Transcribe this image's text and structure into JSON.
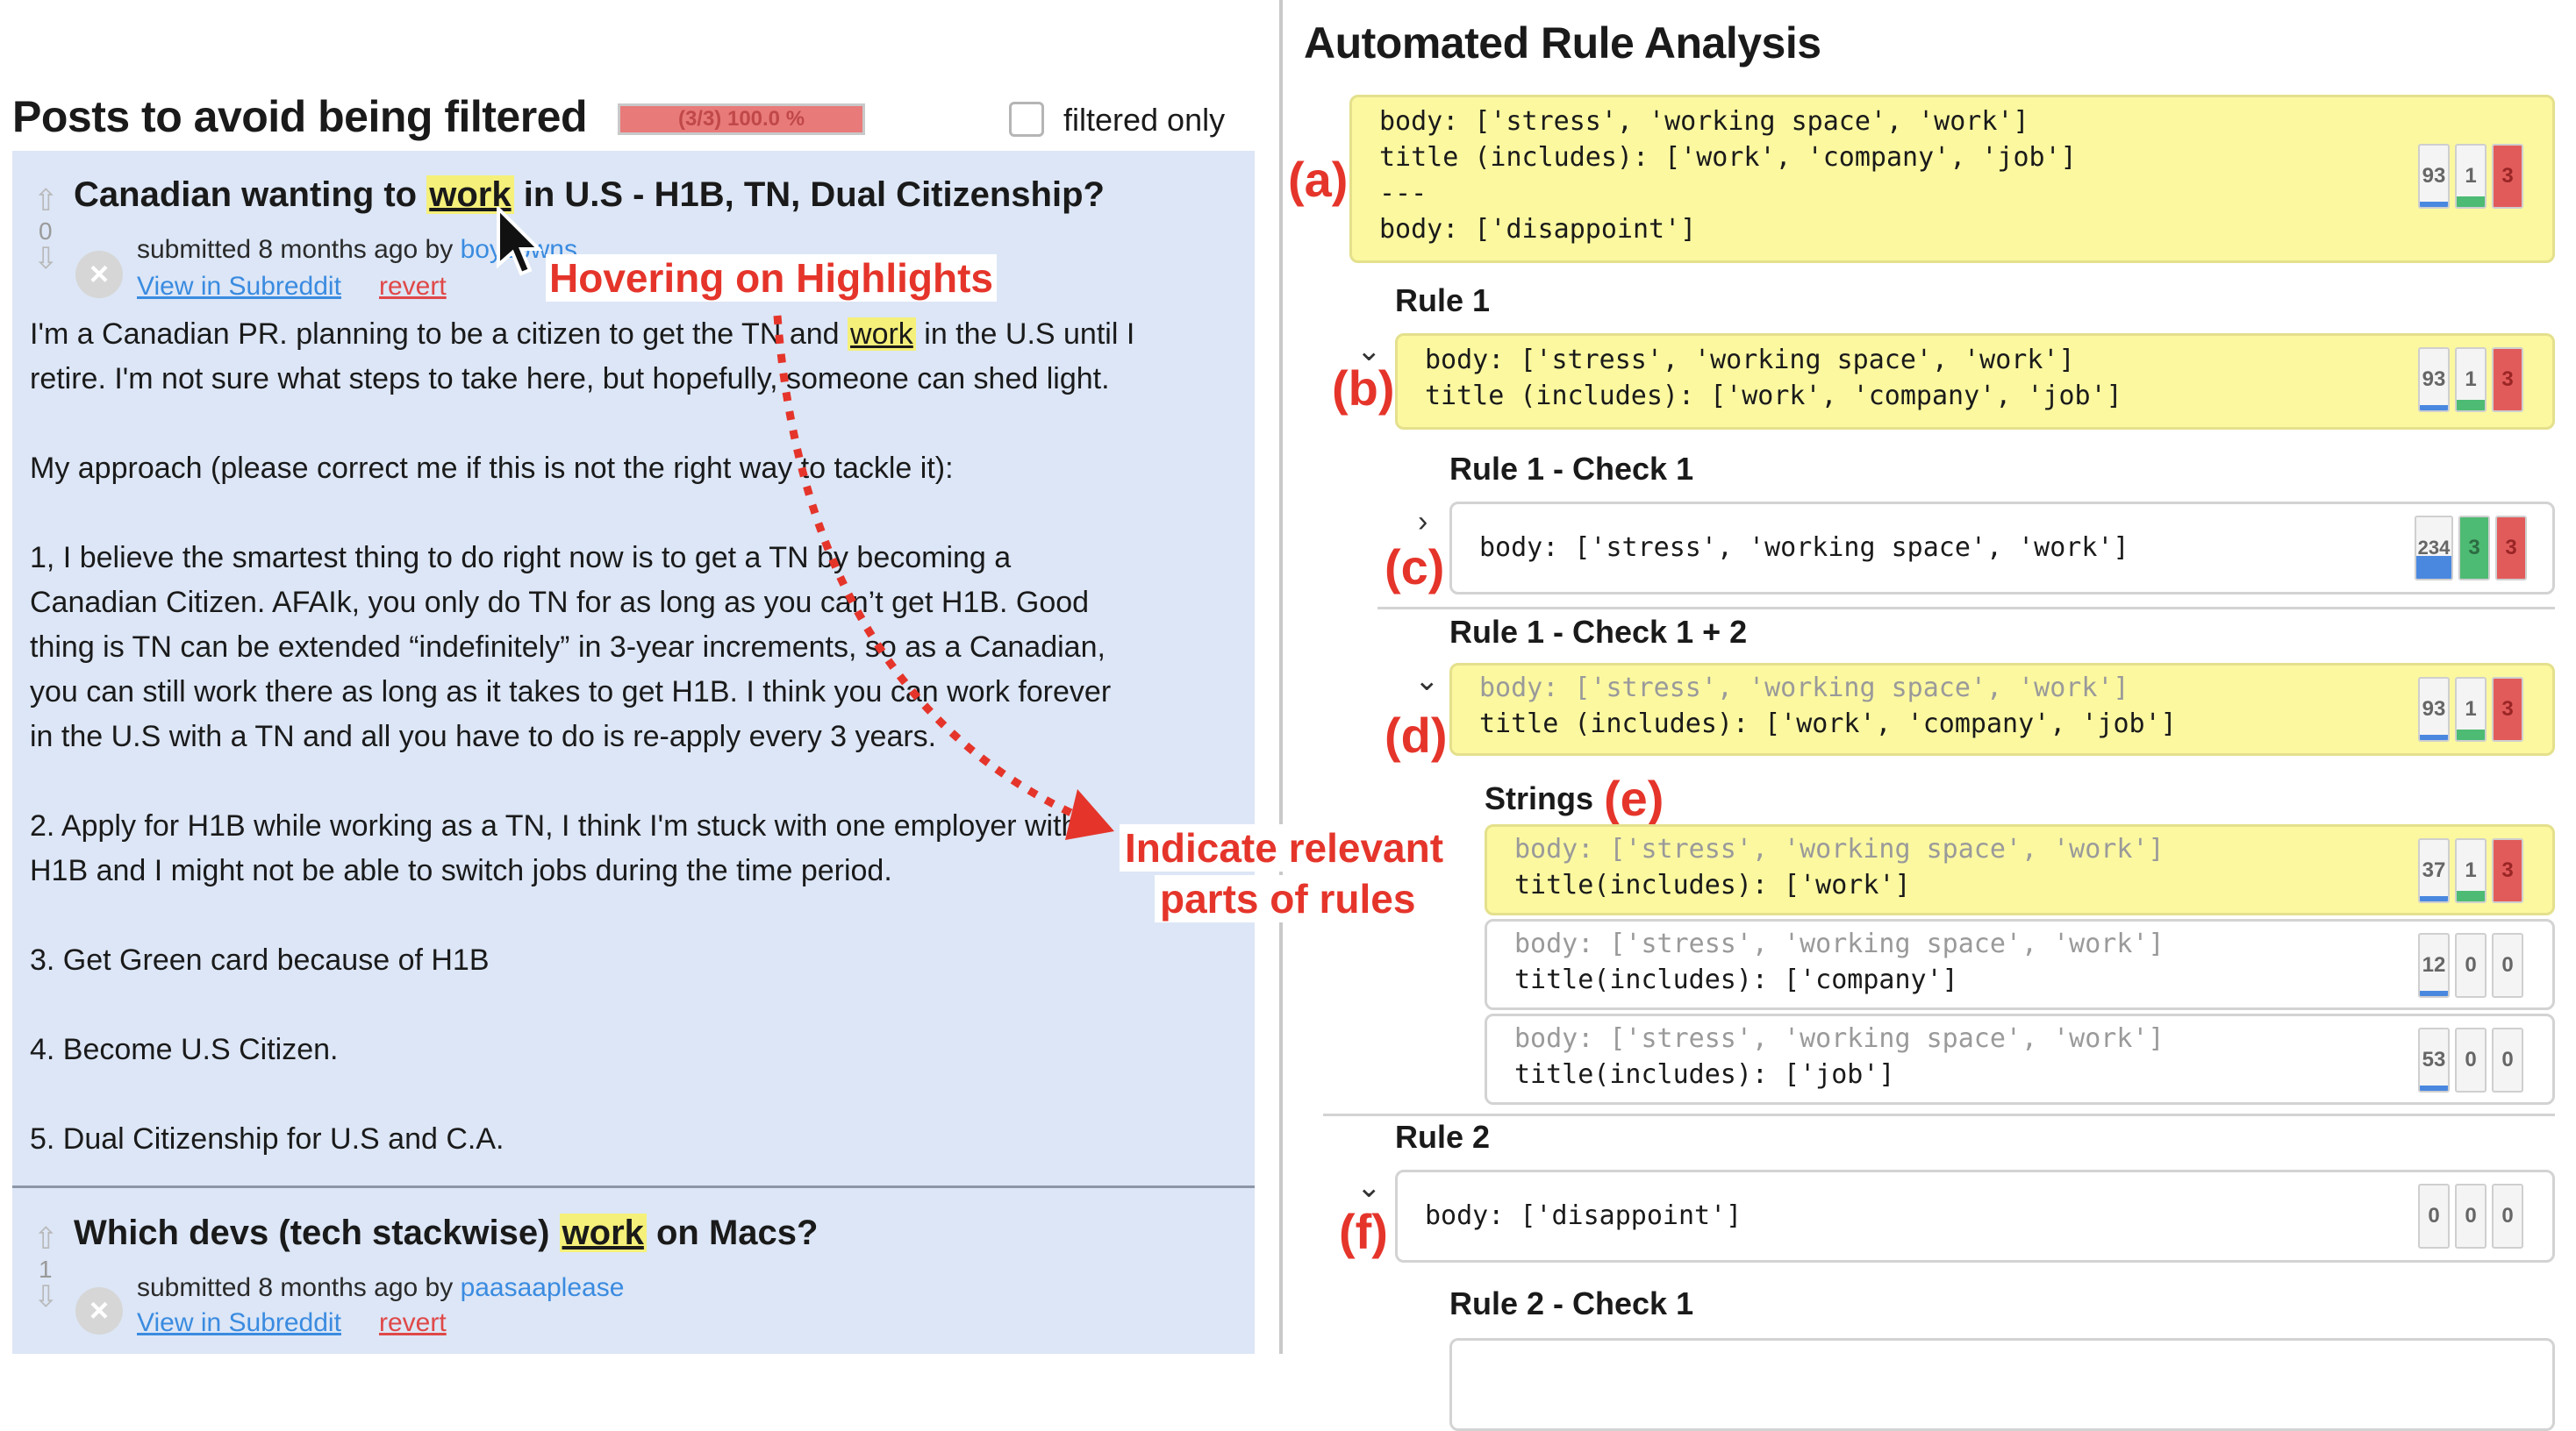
{
  "left": {
    "heading": "Posts to avoid being filtered",
    "progress_text": "(3/3) 100.0 %",
    "filter_label": "filtered only",
    "post1": {
      "title_pre": "Canadian wanting to ",
      "title_hl": "work",
      "title_post": " in U.S - H1B, TN, Dual Citizenship?",
      "vote": "0",
      "meta": "submitted 8 months ago by",
      "author": "boyzpwns",
      "view": "View in Subreddit",
      "revert": "revert",
      "body": {
        "l1a": "I'm a Canadian PR. planning to be a citizen to get the TN and",
        "l1hl": "work",
        "l1b": "in the U.S until I",
        "l2": "retire. I'm not sure what steps to take here, but hopefully, someone can shed light.",
        "l3": "My approach (please correct me if this is not the right way to tackle it):",
        "l4": "1, I believe the smartest thing to do right now is to get a TN by becoming a",
        "l5": "Canadian Citizen. AFAIk, you only do TN for as long as you can’t get H1B. Good",
        "l6": "thing is TN can be extended “indefinitely” in 3-year increments, so as a Canadian,",
        "l7": "you can still work there as long as it takes to get H1B. I think you can work forever",
        "l8": "in the U.S with a TN and all you have to do is re-apply every 3 years.",
        "l9": "2. Apply for H1B while working as a TN, I think I'm stuck with one employer with",
        "l10": "H1B and I might not be able to switch jobs during the time period.",
        "l11": "3. Get Green card because of H1B",
        "l12": "4. Become U.S Citizen.",
        "l13": "5. Dual Citizenship for U.S and C.A."
      }
    },
    "post2": {
      "title_pre": "Which devs (tech stackwise) ",
      "title_hl": "work",
      "title_post": " on Macs?",
      "vote": "1",
      "meta": "submitted 8 months ago by",
      "author": "paasaaplease",
      "view": "View in Subreddit",
      "revert": "revert"
    }
  },
  "annotations": {
    "hover": "Hovering on Highlights",
    "indicate1": "Indicate relevant",
    "indicate2": "parts of rules",
    "a": "(a)",
    "b": "(b)",
    "c": "(c)",
    "d": "(d)",
    "e": "(e)",
    "f": "(f)"
  },
  "right": {
    "heading": "Automated Rule Analysis",
    "overall": {
      "l1": "body: ['stress', 'working space', 'work']",
      "l2": "title (includes): ['work', 'company', 'job']",
      "l3": "---",
      "l4": "body: ['disappoint']",
      "counts": [
        "93",
        "1",
        "3"
      ]
    },
    "rule1": {
      "title": "Rule 1",
      "l1": "body: ['stress', 'working space', 'work']",
      "l2": "title (includes): ['work', 'company', 'job']",
      "counts": [
        "93",
        "1",
        "3"
      ]
    },
    "check1": {
      "title": "Rule 1 - Check 1",
      "l1": "body: ['stress', 'working space', 'work']",
      "counts": [
        "234",
        "3",
        "3"
      ]
    },
    "check12": {
      "title": "Rule 1 - Check 1 + 2",
      "l1": "body: ['stress', 'working space', 'work']",
      "l2": "title (includes): ['work', 'company', 'job']",
      "counts": [
        "93",
        "1",
        "3"
      ]
    },
    "strings": {
      "title": "Strings",
      "s1": {
        "l1": "body: ['stress', 'working space', 'work']",
        "l2": "title(includes): ['work']",
        "counts": [
          "37",
          "1",
          "3"
        ]
      },
      "s2": {
        "l1": "body: ['stress', 'working space', 'work']",
        "l2": "title(includes): ['company']",
        "counts": [
          "12",
          "0",
          "0"
        ]
      },
      "s3": {
        "l1": "body: ['stress', 'working space', 'work']",
        "l2": "title(includes): ['job']",
        "counts": [
          "53",
          "0",
          "0"
        ]
      }
    },
    "rule2": {
      "title": "Rule 2",
      "l1": "body: ['disappoint']",
      "counts": [
        "0",
        "0",
        "0"
      ]
    },
    "rule2check1": {
      "title": "Rule 2 - Check 1"
    }
  }
}
